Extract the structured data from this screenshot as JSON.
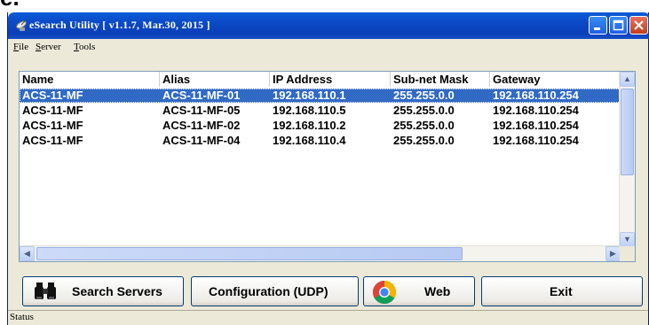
{
  "window": {
    "title": "eSearch Utility [ v1.1.7, Mar.30, 2015 ]"
  },
  "menu": {
    "items": [
      "File",
      "Server",
      "Tools"
    ]
  },
  "table": {
    "headers": [
      "Name",
      "Alias",
      "IP Address",
      "Sub-net Mask",
      "Gateway"
    ],
    "rows": [
      [
        "ACS-11-MF",
        "ACS-11-MF-01",
        "192.168.110.1",
        "255.255.0.0",
        "192.168.110.254"
      ],
      [
        "ACS-11-MF",
        "ACS-11-MF-05",
        "192.168.110.5",
        "255.255.0.0",
        "192.168.110.254"
      ],
      [
        "ACS-11-MF",
        "ACS-11-MF-02",
        "192.168.110.2",
        "255.255.0.0",
        "192.168.110.254"
      ],
      [
        "ACS-11-MF",
        "ACS-11-MF-04",
        "192.168.110.4",
        "255.255.0.0",
        "192.168.110.254"
      ]
    ],
    "selected_row": 0
  },
  "buttons": {
    "search": "Search Servers",
    "config": "Configuration (UDP)",
    "web": "Web",
    "exit": "Exit"
  },
  "status": {
    "text": "Status"
  },
  "colors": {
    "selection": "#316ac5",
    "titlebar": "#0b49c5"
  },
  "icons": {
    "app": "satellite-dish-icon",
    "search": "binoculars-icon",
    "web": "chrome-browser-icon"
  }
}
